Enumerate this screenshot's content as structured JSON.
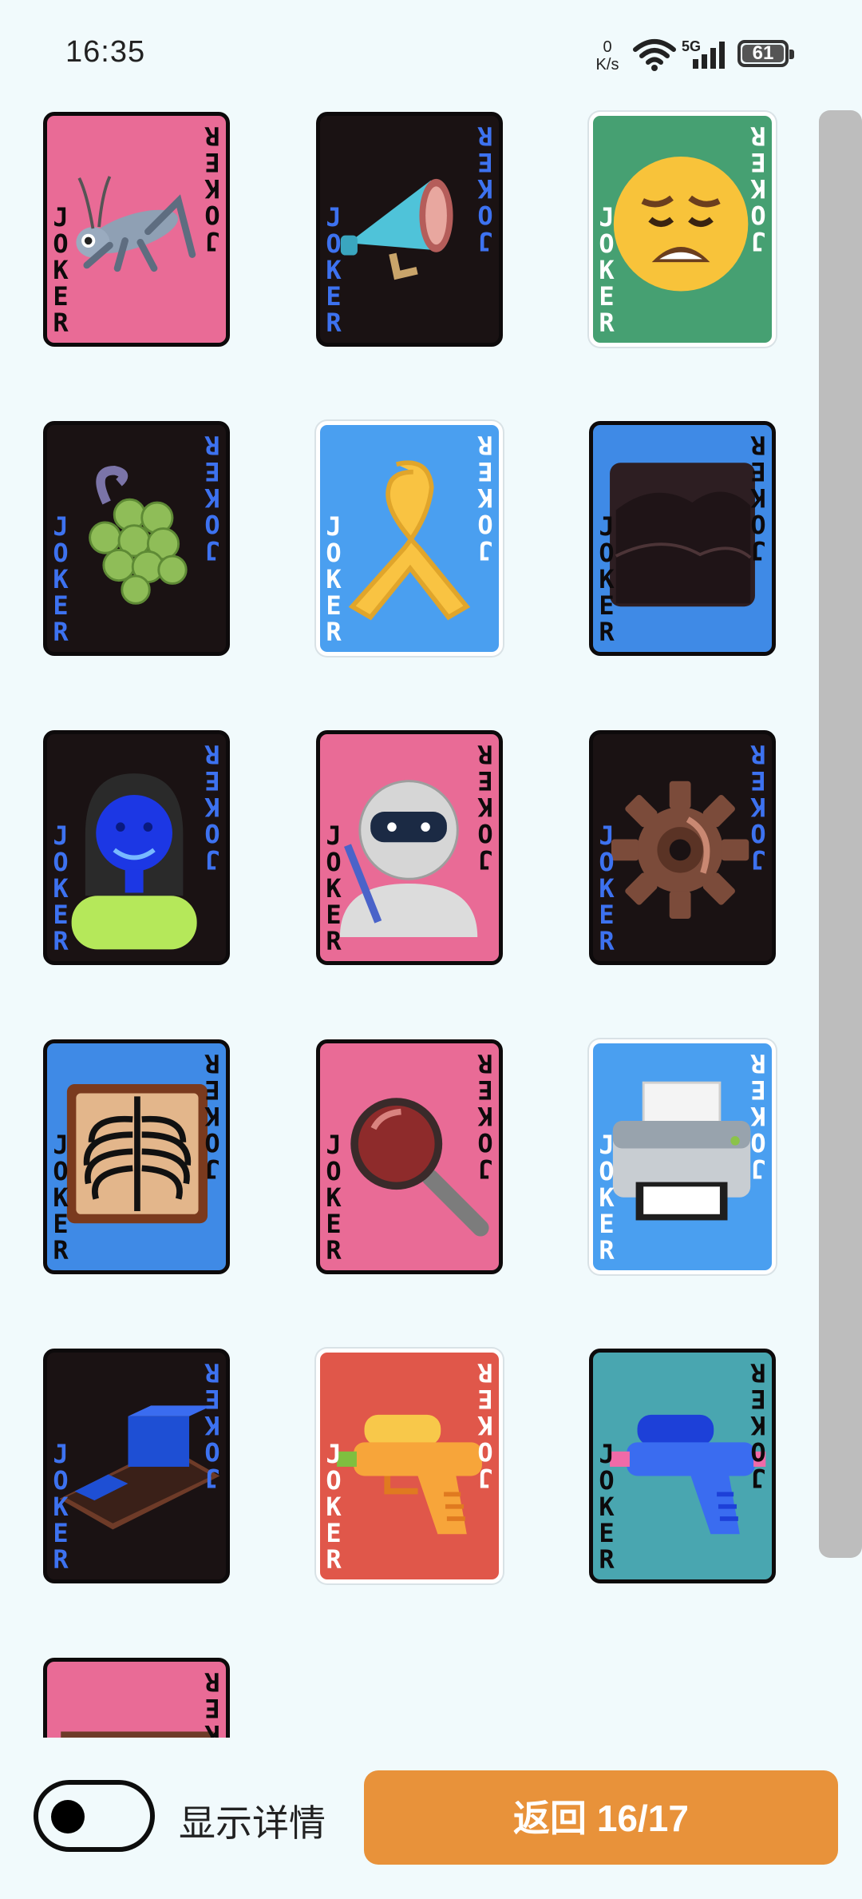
{
  "status_bar": {
    "time": "16:35",
    "net_speed_value": "0",
    "net_speed_unit": "K/s",
    "network": "5G",
    "battery": "61"
  },
  "cards": [
    {
      "label": "JOKER",
      "bg": "#e96b96",
      "text_color": "#0d0a0b",
      "frame": "dark",
      "icon": "cricket-icon"
    },
    {
      "label": "JOKER",
      "bg": "#1a1213",
      "text_color": "#3d72f0",
      "frame": "dark",
      "icon": "megaphone-icon"
    },
    {
      "label": "JOKER",
      "bg": "#46a072",
      "text_color": "#ffffff",
      "frame": "light",
      "icon": "weary-face-icon"
    },
    {
      "label": "JOKER",
      "bg": "#1a1213",
      "text_color": "#3d72f0",
      "frame": "dark",
      "icon": "grapes-icon"
    },
    {
      "label": "JOKER",
      "bg": "#4a9ff0",
      "text_color": "#ffffff",
      "frame": "light",
      "icon": "ribbon-icon"
    },
    {
      "label": "JOKER",
      "bg": "#3f8ae6",
      "text_color": "#0d0a0b",
      "frame": "dark",
      "icon": "dark-clouds-icon"
    },
    {
      "label": "JOKER",
      "bg": "#1a1213",
      "text_color": "#3d72f0",
      "frame": "dark",
      "icon": "woman-icon"
    },
    {
      "label": "JOKER",
      "bg": "#e96b96",
      "text_color": "#0d0a0b",
      "frame": "dark",
      "icon": "ninja-icon"
    },
    {
      "label": "JOKER",
      "bg": "#1a1213",
      "text_color": "#3d72f0",
      "frame": "dark",
      "icon": "gear-icon"
    },
    {
      "label": "JOKER",
      "bg": "#3f8ae6",
      "text_color": "#0d0a0b",
      "frame": "dark",
      "icon": "x-ray-icon"
    },
    {
      "label": "JOKER",
      "bg": "#e96b96",
      "text_color": "#0d0a0b",
      "frame": "dark",
      "icon": "magnifying-glass-icon"
    },
    {
      "label": "JOKER",
      "bg": "#4a9ff0",
      "text_color": "#ffffff",
      "frame": "light",
      "icon": "printer-icon"
    },
    {
      "label": "JOKER",
      "bg": "#1a1213",
      "text_color": "#3d72f0",
      "frame": "dark",
      "icon": "ink-stone-icon"
    },
    {
      "label": "JOKER",
      "bg": "#e0574a",
      "text_color": "#ffffff",
      "frame": "light",
      "icon": "water-pistol-orange-icon"
    },
    {
      "label": "JOKER",
      "bg": "#49a6b0",
      "text_color": "#0d0a0b",
      "frame": "dark",
      "icon": "water-pistol-blue-icon"
    },
    {
      "label": "JOKER",
      "bg": "#e96b96",
      "text_color": "#0d0a0b",
      "frame": "dark",
      "icon": "partial-card-icon"
    }
  ],
  "controls": {
    "toggle_label": "显示详情",
    "toggle_on": false,
    "back_button": "返回 16/17"
  }
}
